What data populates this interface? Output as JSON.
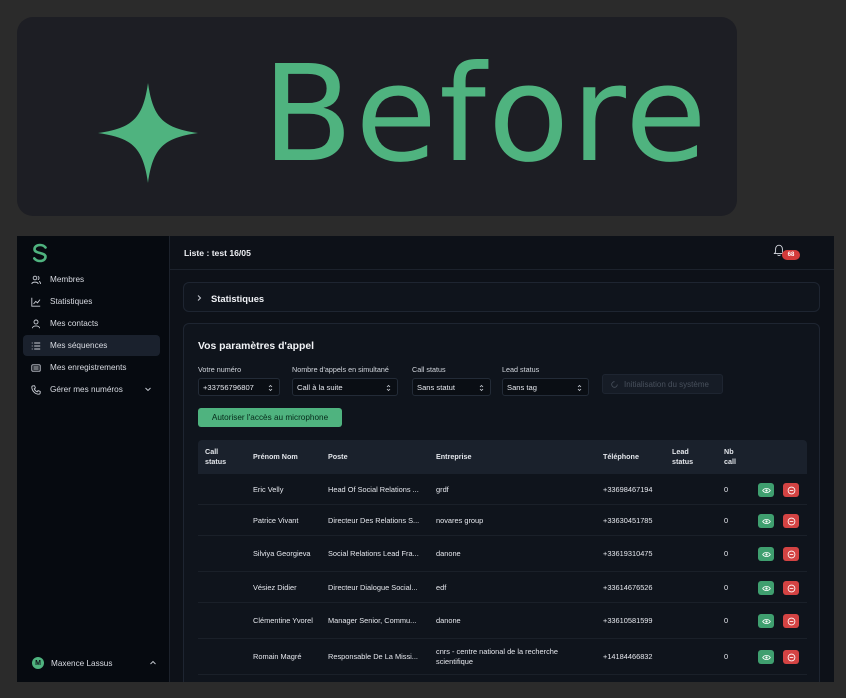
{
  "banner": {
    "word": "Before",
    "color": "#4fb37f"
  },
  "sidebar": {
    "items": [
      {
        "label": "Membres",
        "icon": "users-icon"
      },
      {
        "label": "Statistiques",
        "icon": "chart-icon"
      },
      {
        "label": "Mes contacts",
        "icon": "user-icon"
      },
      {
        "label": "Mes séquences",
        "icon": "list-icon",
        "active": true
      },
      {
        "label": "Mes enregistrements",
        "icon": "recording-icon"
      },
      {
        "label": "Gérer mes numéros",
        "icon": "phone-icon"
      }
    ],
    "user": {
      "initial": "M",
      "name": "Maxence Lassus"
    }
  },
  "header": {
    "title": "Liste : test 16/05",
    "notifications": "68"
  },
  "stats": {
    "title": "Statistiques"
  },
  "params": {
    "title": "Vos paramètres d'appel",
    "fields": [
      {
        "label": "Votre numéro",
        "value": "+33756796807"
      },
      {
        "label": "Nombre d'appels en simultané",
        "value": "Call à la suite"
      },
      {
        "label": "Call status",
        "value": "Sans statut"
      },
      {
        "label": "Lead status",
        "value": "Sans tag"
      }
    ],
    "init_label": "Initialisation du système",
    "mic_label": "Autoriser l'accès au microphone"
  },
  "table": {
    "headers": {
      "call_status": "Call status",
      "name": "Prénom Nom",
      "poste": "Poste",
      "entreprise": "Entreprise",
      "telephone": "Téléphone",
      "lead_status": "Lead status",
      "nb_call": "Nb call"
    },
    "rows": [
      {
        "name": "Eric Velly",
        "poste": "Head Of Social Relations ...",
        "entreprise": "grdf",
        "telephone": "+33698467194",
        "nb_call": "0"
      },
      {
        "name": "Patrice Vivant",
        "poste": "Directeur Des Relations S...",
        "entreprise": "novares group",
        "telephone": "+33630451785",
        "nb_call": "0"
      },
      {
        "name": "Silviya Georgieva",
        "poste": "Social Relations Lead Fra...",
        "entreprise": "danone",
        "telephone": "+33619310475",
        "nb_call": "0"
      },
      {
        "name": "Vésiez Didier",
        "poste": "Directeur Dialogue Social...",
        "entreprise": "edf",
        "telephone": "+33614676526",
        "nb_call": "0"
      },
      {
        "name": "Clémentine Yvorel",
        "poste": "Manager Senior, Commu...",
        "entreprise": "danone",
        "telephone": "+33610581599",
        "nb_call": "0"
      },
      {
        "name": "Romain Magré",
        "poste": "Responsable De La Missi...",
        "entreprise": "cnrs - centre national de la recherche scientifique",
        "telephone": "+14184466832",
        "nb_call": "0"
      }
    ]
  },
  "colors": {
    "accent": "#4fb37f",
    "danger": "#d34343",
    "background": "#0d1118"
  }
}
